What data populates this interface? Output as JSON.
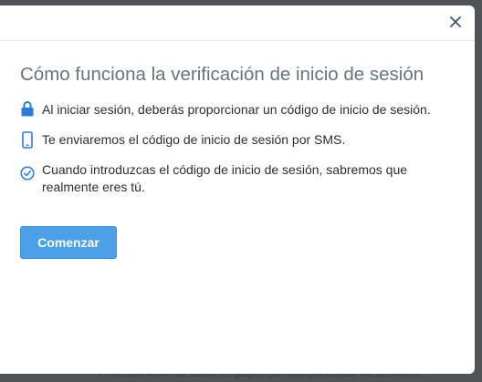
{
  "background": {
    "text": "Procesamiento de datos de pagos por otro proveedor de servicios..."
  },
  "modal": {
    "close_icon": "close-icon",
    "title": "Cómo funciona la verificación de inicio de sesión",
    "items": [
      {
        "icon": "lock-icon",
        "text": "Al iniciar sesión, deberás proporcionar un código de inicio de sesión."
      },
      {
        "icon": "phone-icon",
        "text": "Te enviaremos el código de inicio de sesión por SMS."
      },
      {
        "icon": "check-circle-icon",
        "text": "Cuando introduzcas el código de inicio de sesión, sabremos que realmente eres tú."
      }
    ],
    "start_button": "Comenzar"
  },
  "colors": {
    "accent": "#4ba0e6",
    "title": "#66757f",
    "text": "#292f33",
    "overlay": "#505356"
  }
}
